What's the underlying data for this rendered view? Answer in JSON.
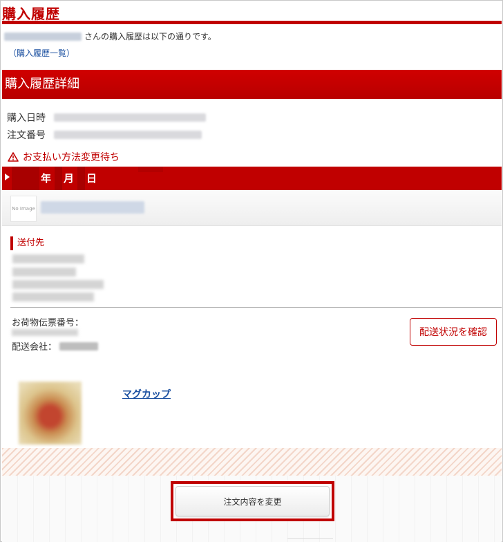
{
  "page": {
    "title": "購入履歴",
    "intro_text": "さんの購入履歴は以下の通りです。",
    "history_link": "（購入履歴一覧）"
  },
  "detail": {
    "section_title": "購入履歴詳細",
    "purchase_date_label": "購入日時",
    "order_number_label": "注文番号",
    "status_warning": "お支払い方法変更待ち"
  },
  "shipment": {
    "date_year_suffix": "年",
    "date_month_suffix": "月",
    "date_day_suffix": "日",
    "shop_thumbnail_text": "No Image",
    "address_label": "送付先",
    "tracking_label": "お荷物伝票番号：",
    "carrier_label": "配送会社：",
    "status_button": "配送状況を確認"
  },
  "item": {
    "name": "マグカップ"
  },
  "actions": {
    "change_order_button": "注文内容を変更"
  },
  "colors": {
    "brand_red": "#c00000",
    "link_blue": "#1a4fa0"
  },
  "icons": [
    "warning-icon",
    "triangle-bullet-icon"
  ]
}
